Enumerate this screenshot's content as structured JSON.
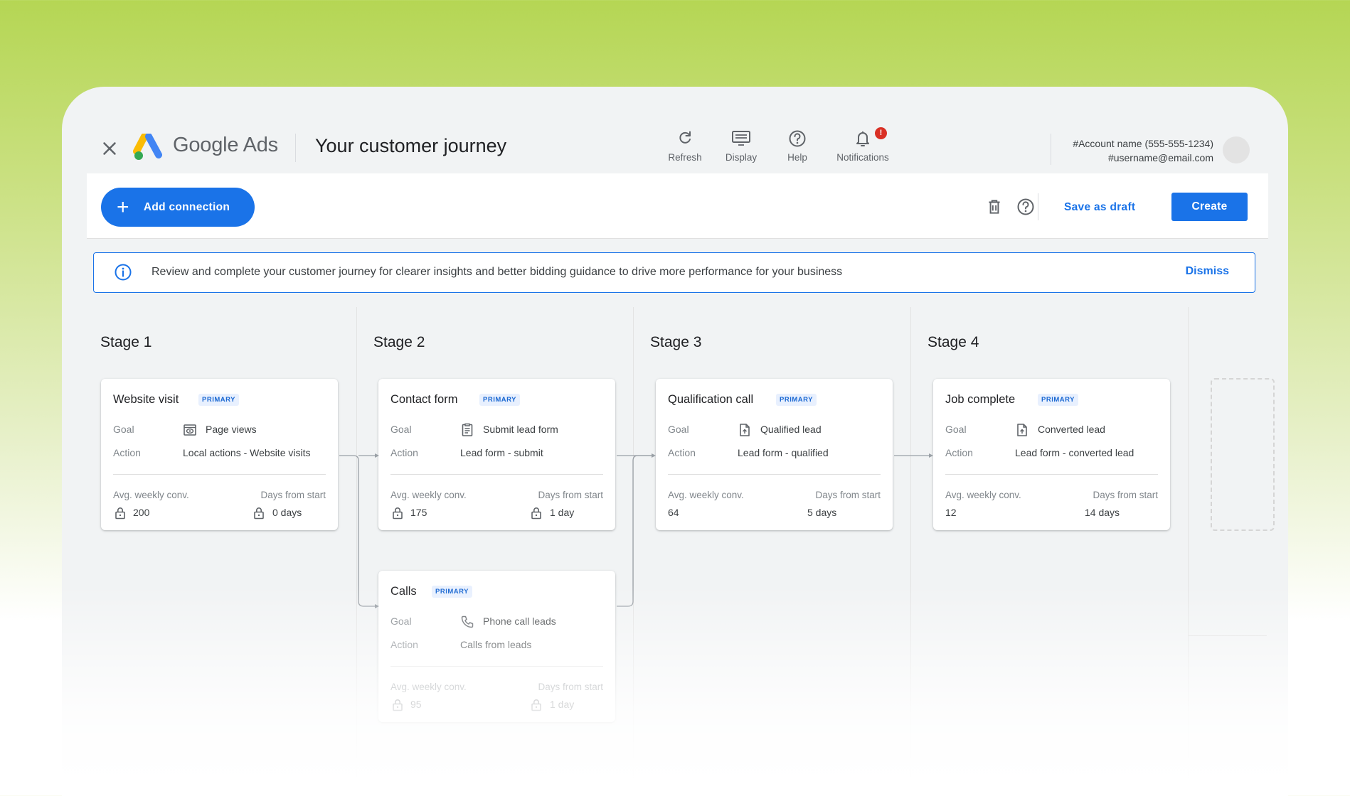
{
  "header": {
    "brand_google": "Google",
    "brand_ads": "Ads",
    "title": "Your customer journey",
    "tools": [
      {
        "label": "Refresh",
        "icon": "refresh-icon"
      },
      {
        "label": "Display",
        "icon": "display-icon"
      },
      {
        "label": "Help",
        "icon": "help-icon"
      },
      {
        "label": "Notifications",
        "icon": "bell-icon",
        "badge": "!"
      }
    ],
    "account_name": "#Account name (555-555-1234)",
    "account_email": "#username@email.com"
  },
  "actionbar": {
    "add_connection": "Add connection",
    "save_draft": "Save as draft",
    "create": "Create"
  },
  "banner": {
    "text": "Review and complete your customer journey for clearer insights and better bidding guidance to drive more performance for your business",
    "dismiss": "Dismiss"
  },
  "colors": {
    "accent": "#1a73e8",
    "alert": "#d93025",
    "badge_bg": "#e8f0fe"
  },
  "labels": {
    "goal": "Goal",
    "action": "Action",
    "avg_weekly_conv": "Avg. weekly conv.",
    "days_from_start": "Days from start",
    "primary": "PRIMARY"
  },
  "stages": [
    {
      "title": "Stage 1",
      "cards": [
        {
          "name": "Website visit",
          "goal_icon": "page-view-icon",
          "goal": "Page views",
          "action": "Local actions - Website visits",
          "avg_weekly_conv": "200",
          "days_from_start": "0 days",
          "locked": true
        }
      ]
    },
    {
      "title": "Stage 2",
      "cards": [
        {
          "name": "Contact form",
          "goal_icon": "form-icon",
          "goal": "Submit lead form",
          "action": "Lead form - submit",
          "avg_weekly_conv": "175",
          "days_from_start": "1 day",
          "locked": true
        },
        {
          "name": "Calls",
          "goal_icon": "phone-icon",
          "goal": "Phone call leads",
          "action": "Calls from leads",
          "avg_weekly_conv": "95",
          "days_from_start": "1 day",
          "locked": true
        }
      ]
    },
    {
      "title": "Stage 3",
      "cards": [
        {
          "name": "Qualification call",
          "goal_icon": "lead-icon",
          "goal": "Qualified lead",
          "action": "Lead form - qualified",
          "avg_weekly_conv": "64",
          "days_from_start": "5 days",
          "locked": false
        }
      ]
    },
    {
      "title": "Stage 4",
      "cards": [
        {
          "name": "Job complete",
          "goal_icon": "lead-icon",
          "goal": "Converted lead",
          "action": "Lead form - converted lead",
          "avg_weekly_conv": "12",
          "days_from_start": "14 days",
          "locked": false
        }
      ]
    }
  ]
}
